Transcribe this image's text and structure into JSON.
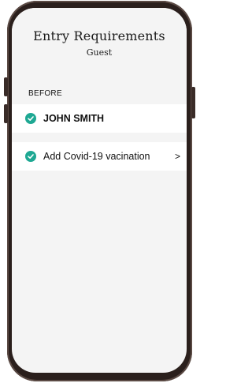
{
  "header": {
    "title": "Entry Requirements",
    "subtitle": "Guest"
  },
  "section": {
    "label": "BEFORE"
  },
  "rows": [
    {
      "label": "JOHN SMITH",
      "status": "complete",
      "icon": "check-circle-icon"
    },
    {
      "label": "Add Covid-19 vacination",
      "status": "complete",
      "icon": "check-circle-icon",
      "action": ">"
    }
  ],
  "colors": {
    "accent": "#1ea893",
    "screen_bg": "#f4f4f4",
    "row_bg": "#ffffff",
    "device_frame": "#2a1f1c"
  }
}
